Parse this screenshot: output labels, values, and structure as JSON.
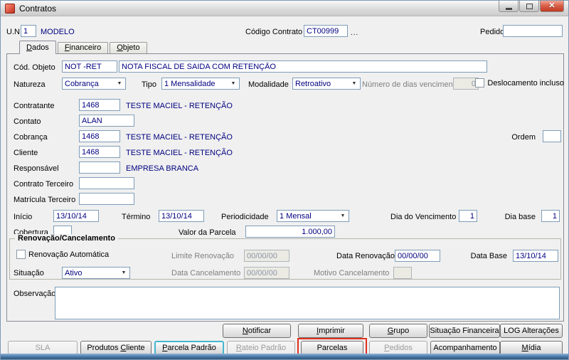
{
  "titlebar": {
    "title": "Contratos"
  },
  "header": {
    "un_label": "U.N.",
    "un_value": "1",
    "un_description": "MODELO",
    "codigo_contrato_label": "Código Contrato",
    "codigo_contrato_value": "CT00999",
    "lookup_label": "...",
    "pedido_label": "Pedido",
    "pedido_value": ""
  },
  "tabs": {
    "active": "Dados",
    "items": [
      {
        "label": "Dados"
      },
      {
        "label": "Financeiro"
      },
      {
        "label": "Objeto"
      }
    ]
  },
  "form": {
    "cod_objeto_label": "Cód. Objeto",
    "cod_objeto_code": "NOT -RET",
    "cod_objeto_desc": "NOTA FISCAL DE SAIDA COM RETENÇÃO",
    "natureza_label": "Natureza",
    "natureza_value": "Cobrança",
    "tipo_label": "Tipo",
    "tipo_value": "1 Mensalidade",
    "modalidade_label": "Modalidade",
    "modalidade_value": "Retroativo",
    "dias_vencimento_label": "Número de dias vencimento",
    "dias_vencimento_value": "0",
    "deslocamento_label": "Deslocamento incluso",
    "contratante_label": "Contratante",
    "contratante_code": "1468",
    "contratante_name": "TESTE MACIEL - RETENÇÃO",
    "contato_label": "Contato",
    "contato_value": "ALAN",
    "cobranca_label": "Cobrança",
    "cobranca_code": "1468",
    "cobranca_name": "TESTE MACIEL - RETENÇÃO",
    "ordem_label": "Ordem",
    "ordem_value": "",
    "cliente_label": "Cliente",
    "cliente_code": "1468",
    "cliente_name": "TESTE MACIEL - RETENÇÃO",
    "responsavel_label": "Responsável",
    "responsavel_code": "",
    "responsavel_name": "EMPRESA BRANCA",
    "contrato_terceiro_label": "Contrato Terceiro",
    "contrato_terceiro_value": "",
    "matricula_terceiro_label": "Matrícula Terceiro",
    "matricula_terceiro_value": "",
    "inicio_label": "Início",
    "inicio_value": "13/10/14",
    "termino_label": "Término",
    "termino_value": "13/10/14",
    "periodicidade_label": "Periodicidade",
    "periodicidade_value": "1 Mensal",
    "dia_vencimento_label": "Dia do Vencimento",
    "dia_vencimento_value": "1",
    "dia_base_label": "Dia base",
    "dia_base_value": "1",
    "cobertura_label": "Cobertura",
    "cobertura_value": "",
    "valor_parcela_label": "Valor da Parcela",
    "valor_parcela_value": "1.000,00",
    "observacao_label": "Observação",
    "observacao_value": ""
  },
  "renovacao": {
    "group_title": "Renovação/Cancelamento",
    "renovacao_automatica_label": "Renovação Automática",
    "limite_renovacao_label": "Limite Renovação",
    "limite_renovacao_value": "00/00/00",
    "data_renovacao_label": "Data Renovação",
    "data_renovacao_value": "00/00/00",
    "data_base_label": "Data Base",
    "data_base_value": "13/10/14",
    "situacao_label": "Situação",
    "situacao_value": "Ativo",
    "data_cancelamento_label": "Data Cancelamento",
    "data_cancelamento_value": "00/00/00",
    "motivo_cancelamento_label": "Motivo Cancelamento",
    "motivo_cancelamento_value": ""
  },
  "footer": {
    "row1": [
      {
        "label": "Notificar"
      },
      {
        "label": "Imprimir"
      },
      {
        "label": "Grupo"
      },
      {
        "label": "Situação Financeira"
      },
      {
        "label": "LOG Alterações"
      }
    ],
    "row2": [
      {
        "label": "SLA",
        "disabled": true
      },
      {
        "label": "Produtos Cliente"
      },
      {
        "label": "Parcela Padrão",
        "focused": true
      },
      {
        "label": "Rateio Padrão",
        "disabled": true
      },
      {
        "label": "Parcelas",
        "highlighted": true
      },
      {
        "label": "Pedidos",
        "disabled": true
      },
      {
        "label": "Acompanhamento"
      },
      {
        "label": "Mídia"
      }
    ]
  },
  "colors": {
    "field_text_navy": "#000080",
    "annotation_box_red": "#E0301E",
    "default_button_focus_teal": "#46B5CF",
    "disabled_label_gray": "#808080"
  }
}
